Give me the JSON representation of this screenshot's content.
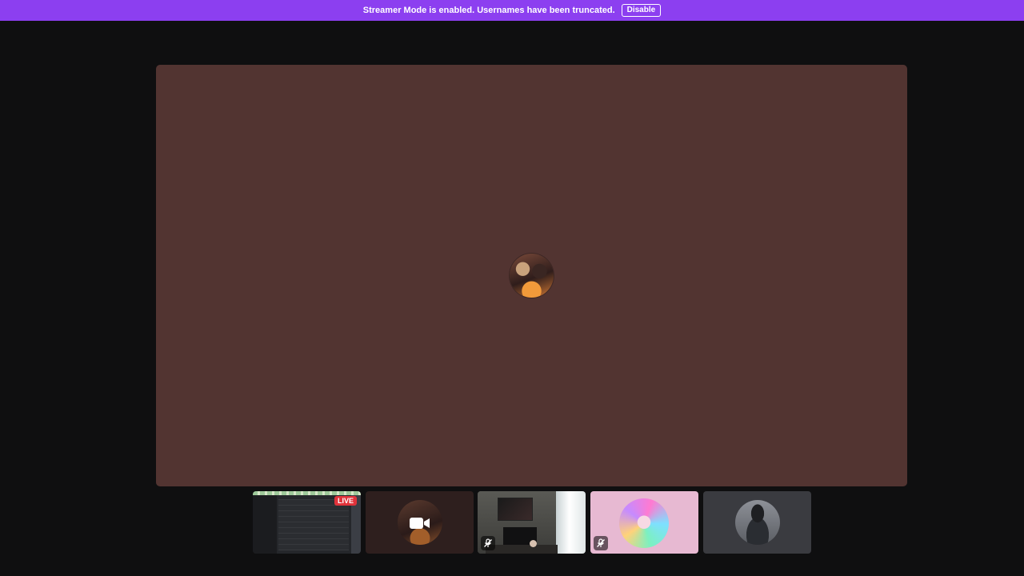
{
  "banner": {
    "message": "Streamer Mode is enabled. Usernames have been truncated.",
    "disable_label": "Disable",
    "color": "#8c3ff0"
  },
  "stage": {
    "background": "#523431",
    "avatar_icon": "user-avatar-icon"
  },
  "tiles": [
    {
      "kind": "screen-share",
      "badge": "LIVE"
    },
    {
      "kind": "camera-off",
      "icon": "camera-icon"
    },
    {
      "kind": "video",
      "muted": true,
      "icon": "mic-muted-icon"
    },
    {
      "kind": "avatar",
      "muted": true,
      "icon": "mic-muted-icon"
    },
    {
      "kind": "avatar"
    }
  ],
  "colors": {
    "live": "#e1333b",
    "page_background": "#0f0f10"
  }
}
